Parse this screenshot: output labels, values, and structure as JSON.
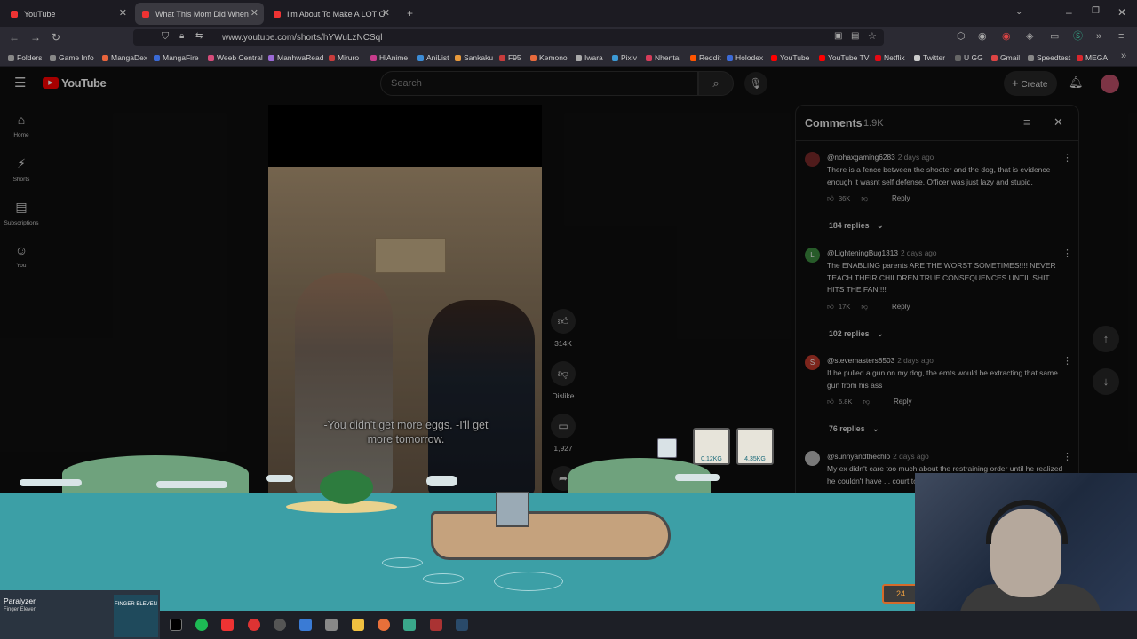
{
  "browser": {
    "tabs": [
      {
        "title": "YouTube"
      },
      {
        "title": "What This Mom Did When"
      },
      {
        "title": "I'm About To Make A LOT Of Pe"
      }
    ],
    "url": "www.youtube.com/shorts/hYWuLzNCSql",
    "bookmarks": [
      {
        "label": "Folders",
        "color": "#888"
      },
      {
        "label": "Game Info",
        "color": "#888"
      },
      {
        "label": "MangaDex",
        "color": "#e8643c"
      },
      {
        "label": "MangaFire",
        "color": "#3a6ad6"
      },
      {
        "label": "Weeb Central",
        "color": "#d64c7a"
      },
      {
        "label": "ManhwaRead",
        "color": "#9b6ad6"
      },
      {
        "label": "Miruro",
        "color": "#c83c3c"
      },
      {
        "label": "HiAnime",
        "color": "#c83c8c"
      },
      {
        "label": "AniList",
        "color": "#3c8cd6"
      },
      {
        "label": "Sankaku",
        "color": "#e89a3c"
      },
      {
        "label": "F95",
        "color": "#c83c3c"
      },
      {
        "label": "Kemono",
        "color": "#e86a3c"
      },
      {
        "label": "Iwara",
        "color": "#aaa"
      },
      {
        "label": "Pixiv",
        "color": "#3c9ad6"
      },
      {
        "label": "Nhentai",
        "color": "#d63c5a"
      },
      {
        "label": "Reddit",
        "color": "#ff5500"
      },
      {
        "label": "Holodex",
        "color": "#3c6ad6"
      },
      {
        "label": "YouTube",
        "color": "#f00"
      },
      {
        "label": "YouTube TV",
        "color": "#f00"
      },
      {
        "label": "Netflix",
        "color": "#e50914"
      },
      {
        "label": "Twitter",
        "color": "#ccc"
      },
      {
        "label": "U GG",
        "color": "#666"
      },
      {
        "label": "Gmail",
        "color": "#d44"
      },
      {
        "label": "Speedtest",
        "color": "#888"
      },
      {
        "label": "MEGA",
        "color": "#d9272e"
      }
    ]
  },
  "youtube": {
    "logo": "YouTube",
    "search_placeholder": "Search",
    "create_label": "Create",
    "sidebar": [
      {
        "label": "Home",
        "icon": "home-icon"
      },
      {
        "label": "Shorts",
        "icon": "shorts-icon"
      },
      {
        "label": "Subscriptions",
        "icon": "subscriptions-icon"
      },
      {
        "label": "You",
        "icon": "you-icon"
      }
    ],
    "video": {
      "subtitle_line1": "-You didn't get more eggs. -I'll get",
      "subtitle_line2": "more tomorrow."
    },
    "actions": {
      "likes": "314K",
      "dislike_label": "Dislike",
      "comments": "1,927"
    },
    "comments": {
      "title": "Comments",
      "count": "1.9K",
      "items": [
        {
          "author": "@nohaxgaming6283",
          "date": "2 days ago",
          "text": "There is a fence between the shooter and the dog, that is evidence enough it wasnt self defense. Officer was just lazy and stupid.",
          "likes": "36K",
          "reply_label": "Reply",
          "replies": "184 replies",
          "avatar_color": "#7a2a2a",
          "avatar_letter": ""
        },
        {
          "author": "@LighteningBug1313",
          "date": "2 days ago",
          "text": "The ENABLING parents ARE THE WORST SOMETIMES!!!! NEVER TEACH THEIR CHILDREN TRUE CONSEQUENCES UNTIL SHIT HITS THE FAN!!!!",
          "likes": "17K",
          "reply_label": "Reply",
          "replies": "102 replies",
          "avatar_color": "#3d8c40",
          "avatar_letter": "L"
        },
        {
          "author": "@stevemasters8503",
          "date": "2 days ago",
          "text": "If he pulled a gun on my dog, the emts would be extracting that same gun from his ass",
          "likes": "5.8K",
          "reply_label": "Reply",
          "replies": "76 replies",
          "avatar_color": "#c0392b",
          "avatar_letter": "S"
        },
        {
          "author": "@sunnyandthechlo",
          "date": "2 days ago",
          "text": "My ex didn't care too much about the restraining order until he realized he couldn't have ... court to have it remo...",
          "avatar_color": "#bbb",
          "avatar_letter": ""
        }
      ]
    }
  },
  "game": {
    "hud": [
      {
        "label": "0.12KG"
      },
      {
        "label": "4.35KG"
      }
    ],
    "coins": "24"
  },
  "music": {
    "title": "Paralyzer",
    "artist": "Finger Eleven",
    "album_art_text": "FINGER ELEVEN"
  }
}
